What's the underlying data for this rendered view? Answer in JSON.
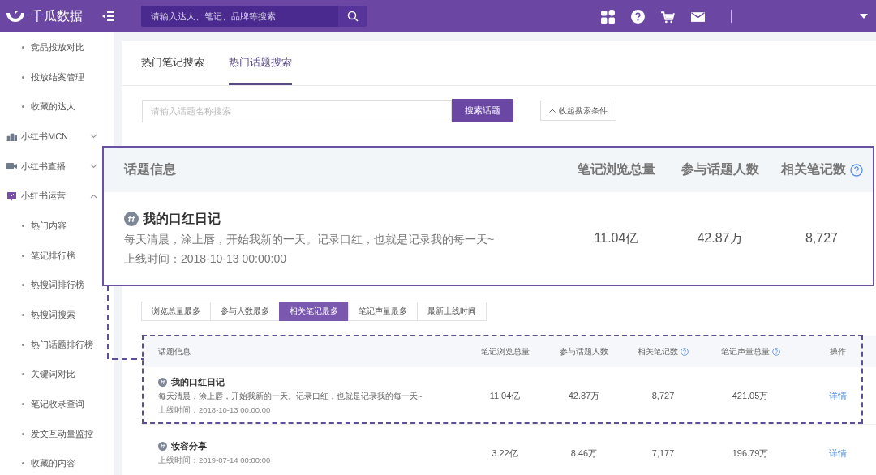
{
  "header": {
    "brand": "千瓜数据",
    "search_placeholder": "请输入达人、笔记、品牌等搜索"
  },
  "sidebar": {
    "items": [
      {
        "kind": "sub",
        "label": "竞品投放对比"
      },
      {
        "kind": "sub",
        "label": "投放结案管理"
      },
      {
        "kind": "sub",
        "label": "收藏的达人"
      },
      {
        "kind": "group",
        "label": "小红书MCN",
        "expanded": false
      },
      {
        "kind": "group",
        "label": "小红书直播",
        "expanded": false
      },
      {
        "kind": "group",
        "label": "小红书运营",
        "expanded": true,
        "children": [
          {
            "kind": "sub",
            "label": "热门内容"
          },
          {
            "kind": "sub",
            "label": "笔记排行榜"
          },
          {
            "kind": "sub",
            "label": "热搜词排行榜"
          },
          {
            "kind": "sub",
            "label": "热搜词搜索"
          },
          {
            "kind": "sub",
            "label": "热门话题排行榜"
          },
          {
            "kind": "sub",
            "label": "关键词对比"
          },
          {
            "kind": "sub",
            "label": "笔记收录查询"
          },
          {
            "kind": "sub",
            "label": "发文互动量监控"
          },
          {
            "kind": "sub",
            "label": "收藏的内容"
          }
        ]
      }
    ]
  },
  "tabs": [
    {
      "label": "热门笔记搜索",
      "selected": false
    },
    {
      "label": "热门话题搜索",
      "selected": true
    }
  ],
  "topic_search": {
    "placeholder": "请输入话题名称搜索",
    "button": "搜索话题",
    "collapse": "收起搜索条件"
  },
  "sort_buttons": [
    {
      "label": "浏览总量最多",
      "selected": false
    },
    {
      "label": "参与人数最多",
      "selected": false
    },
    {
      "label": "相关笔记最多",
      "selected": true
    },
    {
      "label": "笔记声量最多",
      "selected": false
    },
    {
      "label": "最新上线时间",
      "selected": false
    }
  ],
  "table": {
    "columns": [
      {
        "label": "话题信息",
        "help": false
      },
      {
        "label": "笔记浏览总量",
        "help": false
      },
      {
        "label": "参与话题人数",
        "help": false
      },
      {
        "label": "相关笔记数",
        "help": true
      },
      {
        "label": "笔记声量总量",
        "help": true
      },
      {
        "label": "操作",
        "help": false
      }
    ],
    "rows": [
      {
        "title": "我的口红日记",
        "description": "每天清晨，涂上唇，开始我新的一天。记录口红，也就是记录我的每一天~",
        "online_time": "上线时间：2018-10-13 00:00:00",
        "views": "11.04亿",
        "participants": "42.87万",
        "notes": "8,727",
        "volume": "421.05万",
        "action": "详情"
      },
      {
        "title": "妆容分享",
        "online_time": "上线时间：2019-07-14 00:00:00",
        "views": "3.22亿",
        "participants": "8.46万",
        "notes": "7,177",
        "volume": "196.79万",
        "action": "详情"
      }
    ]
  },
  "magnified_card": {
    "columns": [
      {
        "label": "话题信息",
        "help": false
      },
      {
        "label": "笔记浏览总量",
        "help": false
      },
      {
        "label": "参与话题人数",
        "help": false
      },
      {
        "label": "相关笔记数",
        "help": true
      }
    ],
    "row": {
      "title": "我的口红日记",
      "description": "每天清晨，涂上唇，开始我新的一天。记录口红，也就是记录我的每一天~",
      "online_time": "上线时间：2018-10-13 00:00:00",
      "views": "11.04亿",
      "participants": "42.87万",
      "notes": "8,727"
    }
  }
}
